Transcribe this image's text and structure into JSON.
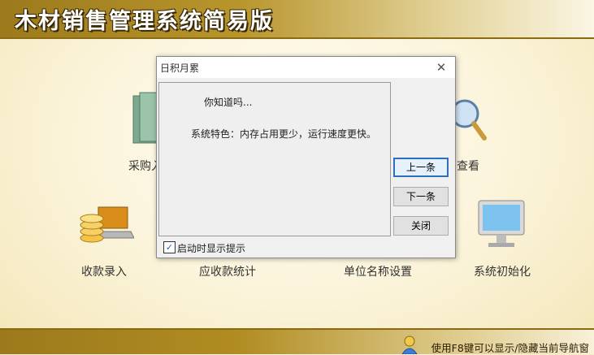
{
  "app": {
    "title": "木材销售管理系统简易版"
  },
  "tiles": [
    {
      "label": "采购入",
      "icon": "books-icon"
    },
    {
      "label": "查看",
      "icon": "magnifier-icon"
    },
    {
      "label": "收款录入",
      "icon": "coins-laptop-icon"
    },
    {
      "label": "应收款统计",
      "icon": ""
    },
    {
      "label": "单位名称设置",
      "icon": ""
    },
    {
      "label": "系统初始化",
      "icon": "monitor-icon"
    }
  ],
  "dialog": {
    "title": "日积月累",
    "close": "✕",
    "tip_heading": "你知道吗...",
    "tip_text": "系统特色：内存占用更少，运行速度更快。",
    "buttons": {
      "prev": "上一条",
      "next": "下一条",
      "close": "关闭"
    },
    "show_on_startup": {
      "label": "启动时显示提示",
      "checked": true,
      "mark": "✓"
    }
  },
  "footer": {
    "hint": "使用F8键可以显示/隐藏当前导航窗"
  }
}
